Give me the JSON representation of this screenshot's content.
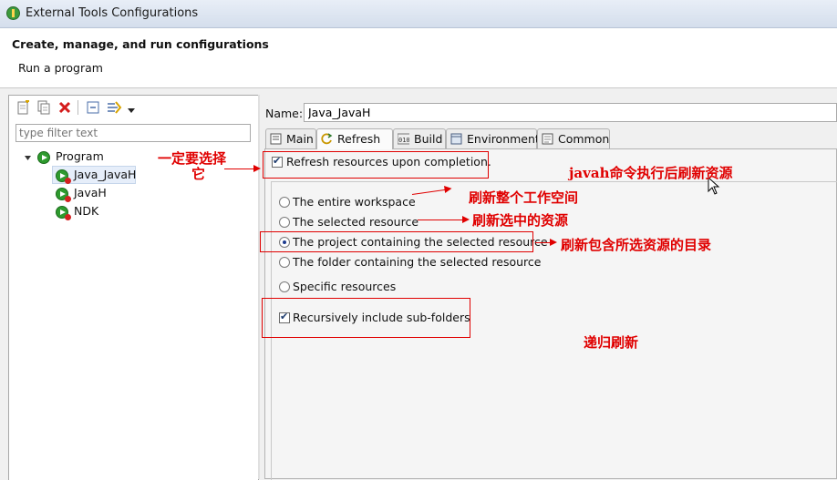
{
  "window": {
    "title": "External Tools Configurations"
  },
  "header": {
    "title": "Create, manage, and run configurations",
    "subtitle": "Run a program"
  },
  "toolbar": {
    "buttons": [
      {
        "icon": "new-config-icon"
      },
      {
        "icon": "duplicate-icon"
      },
      {
        "icon": "delete-icon"
      },
      {
        "icon": "collapse-all-icon"
      },
      {
        "icon": "filter-icon"
      },
      {
        "icon": "dropdown-icon"
      }
    ]
  },
  "filter": {
    "placeholder": "type filter text"
  },
  "tree": {
    "category": "Program",
    "items": [
      {
        "label": "Java_JavaH",
        "selected": true
      },
      {
        "label": "JavaH",
        "selected": false
      },
      {
        "label": "NDK",
        "selected": false
      }
    ]
  },
  "config": {
    "name_label": "Name:",
    "name_value": "Java_JavaH",
    "tabs": [
      {
        "label": "Main",
        "icon": "main-tab-icon"
      },
      {
        "label": "Refresh",
        "icon": "refresh-icon",
        "active": true
      },
      {
        "label": "Build",
        "icon": "build-icon"
      },
      {
        "label": "Environment",
        "icon": "environment-icon"
      },
      {
        "label": "Common",
        "icon": "common-icon"
      }
    ],
    "refresh_checkbox": {
      "label": "Refresh resources upon completion.",
      "checked": true
    },
    "scope_options": [
      {
        "label": "The entire workspace",
        "selected": false
      },
      {
        "label": "The selected resource",
        "selected": false
      },
      {
        "label": "The project containing the selected resource",
        "selected": true
      },
      {
        "label": "The folder containing the selected resource",
        "selected": false
      },
      {
        "label": "Specific resources",
        "selected": false
      }
    ],
    "recursive_checkbox": {
      "label": "Recursively include sub-folders",
      "checked": true
    }
  },
  "annotations": {
    "must_select_line1": "一定要选择",
    "must_select_line2": "它",
    "javah_note": "javah命令执行后刷新资源",
    "workspace_note": "刷新整个工作空间",
    "selected_note": "刷新选中的资源",
    "project_note": "刷新包含所选资源的目录",
    "recursive_note": "递归刷新",
    "color": "#e00000"
  }
}
